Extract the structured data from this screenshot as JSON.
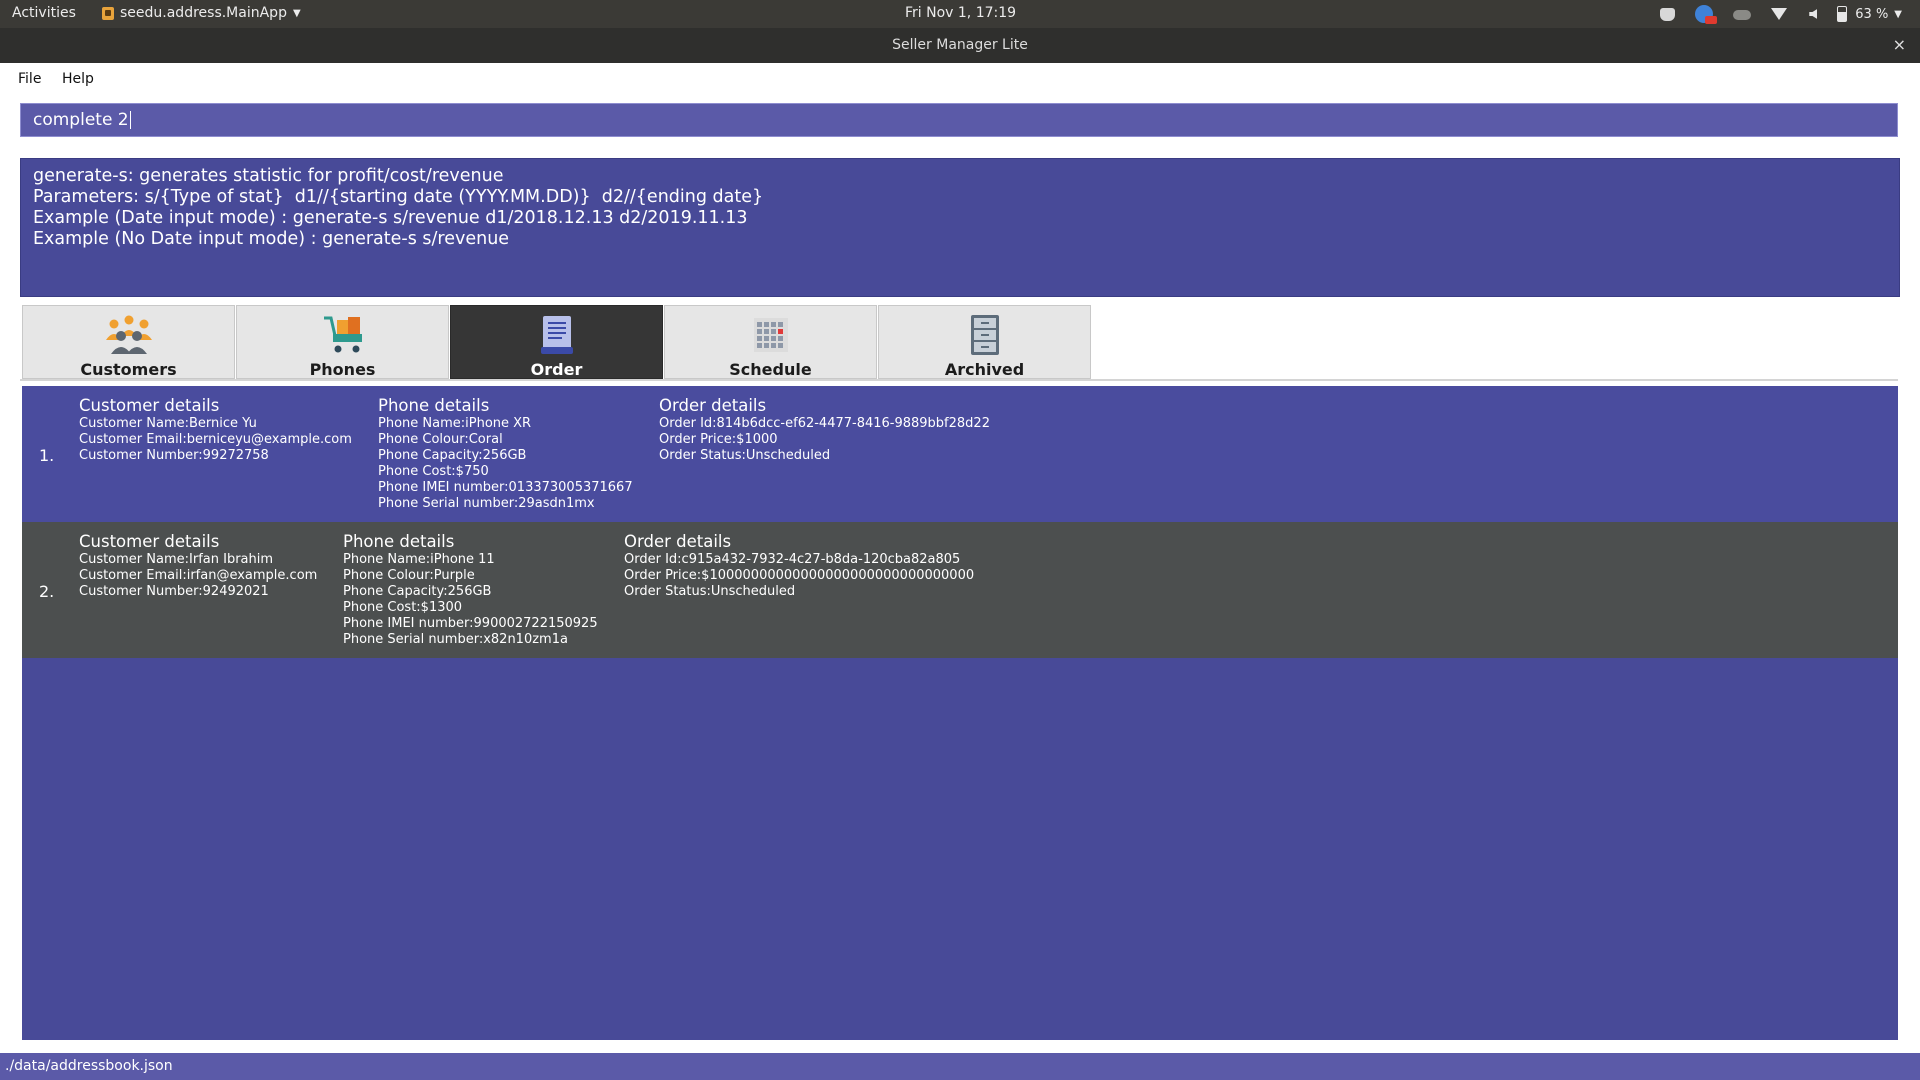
{
  "system_bar": {
    "activities": "Activities",
    "app_name": "seedu.address.MainApp",
    "clock": "Fri Nov  1, 17:19",
    "battery": "63 %"
  },
  "window": {
    "title": "Seller Manager Lite",
    "close": "×"
  },
  "menu": {
    "items": [
      "File",
      "Help"
    ]
  },
  "command_box": {
    "value": "complete 2"
  },
  "result_display": {
    "lines": [
      "generate-s: generates statistic for profit/cost/revenue",
      "Parameters: s/{Type of stat}  d1//{starting date (YYYY.MM.DD)}  d2//{ending date}",
      "Example (Date input mode) : generate-s s/revenue d1/2018.12.13 d2/2019.11.13",
      "Example (No Date input mode) : generate-s s/revenue"
    ]
  },
  "tabs": [
    {
      "label": "Customers",
      "icon": "customers-icon",
      "active": false
    },
    {
      "label": "Phones",
      "icon": "cart-icon",
      "active": false
    },
    {
      "label": "Order",
      "icon": "order-icon",
      "active": true
    },
    {
      "label": "Schedule",
      "icon": "calendar-icon",
      "active": false
    },
    {
      "label": "Archived",
      "icon": "archive-icon",
      "active": false
    }
  ],
  "orders": [
    {
      "index": "1.",
      "customer": {
        "heading": "Customer details",
        "lines": [
          "Customer Name:Bernice Yu",
          "Customer Email:berniceyu@example.com",
          "Customer Number:99272758"
        ]
      },
      "phone": {
        "heading": "Phone details",
        "lines": [
          "Phone Name:iPhone XR",
          "Phone Colour:Coral",
          "Phone Capacity:256GB",
          "Phone Cost:$750",
          "Phone IMEI number:013373005371667",
          "Phone Serial number:29asdn1mx"
        ]
      },
      "order": {
        "heading": "Order details",
        "lines": [
          "Order Id:814b6dcc-ef62-4477-8416-9889bbf28d22",
          "Order Price:$1000",
          "Order Status:Unscheduled"
        ]
      }
    },
    {
      "index": "2.",
      "customer": {
        "heading": "Customer details",
        "lines": [
          "Customer Name:Irfan Ibrahim",
          "Customer Email:irfan@example.com",
          "Customer Number:92492021"
        ]
      },
      "phone": {
        "heading": "Phone details",
        "lines": [
          "Phone Name:iPhone 11",
          "Phone Colour:Purple",
          "Phone Capacity:256GB",
          "Phone Cost:$1300",
          "Phone IMEI number:990002722150925",
          "Phone Serial number:x82n10zm1a"
        ]
      },
      "order": {
        "heading": "Order details",
        "lines": [
          "Order Id:c915a432-7932-4c27-b8da-120cba82a805",
          "Order Price:$10000000000000000000000000000000",
          "Order Status:Unscheduled"
        ]
      }
    }
  ],
  "status_bar": {
    "path": "./data/addressbook.json"
  },
  "colors": {
    "panel": "#484a98",
    "command_box": "#5b5aa8",
    "row_alt": "#4c4f4f",
    "tab_active": "#363636"
  }
}
